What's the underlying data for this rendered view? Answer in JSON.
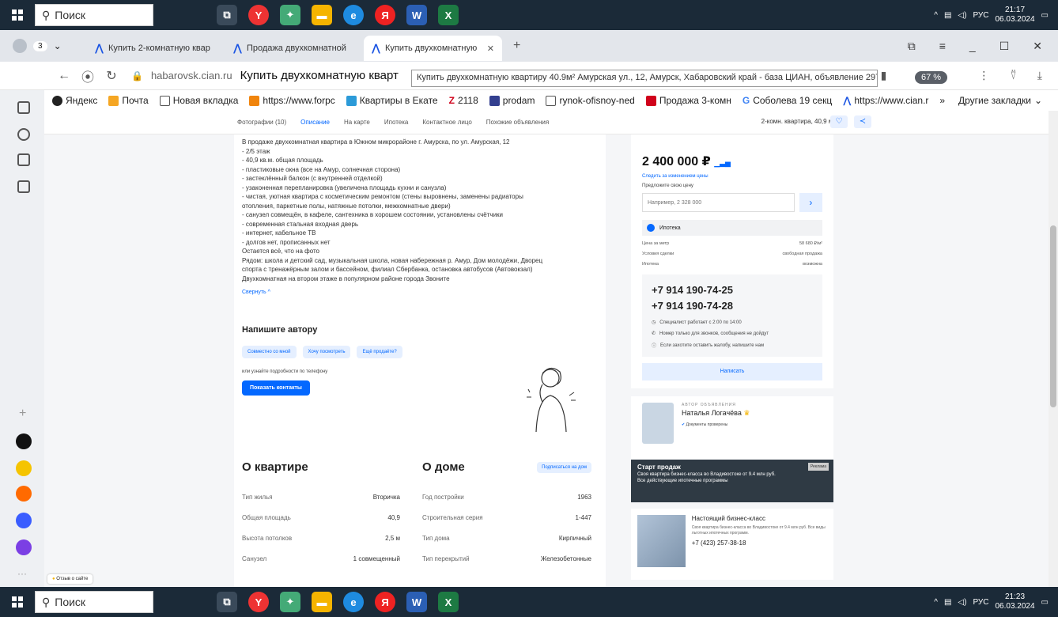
{
  "taskbar_top": {
    "search_placeholder": "Поиск",
    "lang": "РУС",
    "time": "21:17",
    "date": "06.03.2024"
  },
  "taskbar_bottom": {
    "search_placeholder": "Поиск",
    "lang": "РУС",
    "time": "21:23",
    "date": "06.03.2024"
  },
  "tabs": [
    {
      "label": "Купить 2-комнатную квар"
    },
    {
      "label": "Продажа двухкомнатной"
    },
    {
      "label": "Купить двухкомнатную"
    }
  ],
  "address": {
    "domain": "habarovsk.cian.ru",
    "title": "Купить двухкомнатную кварт",
    "tooltip": "Купить двухкомнатную квартиру 40.9м² Амурская ул., 12, Амурск, Хабаровский край - база ЦИАН, объявление 297926562",
    "zoom": "67 %"
  },
  "bookmarks": [
    {
      "label": "Яндекс",
      "color": "#222222"
    },
    {
      "label": "Почта",
      "color": "#f5a623"
    },
    {
      "label": "Новая вкладка",
      "color": "#ffffff"
    },
    {
      "label": "https://www.forpc",
      "color": "#f0840c"
    },
    {
      "label": "Квартиры в Екате",
      "color": "#2b9ad8"
    },
    {
      "label": "2118",
      "color": "#d0021b"
    },
    {
      "label": "prodam",
      "color": "#333f8f"
    },
    {
      "label": "rynok-ofisnoy-ned",
      "color": "#ffffff"
    },
    {
      "label": "Продажа 3-комн",
      "color": "#d0021b"
    },
    {
      "label": "Соболева 19 секц",
      "color": "#4285f4"
    },
    {
      "label": "https://www.cian.r",
      "color": "#1b55e3"
    }
  ],
  "bookmarks_more": "Другие закладки",
  "page_nav": {
    "items": [
      "Фотографии (10)",
      "Описание",
      "На карте",
      "Ипотека",
      "Контактное лицо",
      "Похожие объявления"
    ],
    "summary": "2-комн. квартира, 40,9 м²"
  },
  "description": [
    "В продаже двухкомнатная квартира в Южном микрорайоне г. Амурска, по ул. Амурская, 12",
    "- 2/5 этаж",
    "- 40,9 кв.м. общая площадь",
    "- пластиковые окна (все на Амур, солнечная сторона)",
    "- застеклённый балкон (с внутренней отделкой)",
    "- узаконенная перепланировка (увеличена площадь кухни и санузла)",
    "- чистая, уютная квартира с косметическим ремонтом (стены выровнены, заменены радиаторы",
    "отопления, паркетные полы, натяжные потолки, межкомнатные двери)",
    "- санузел совмещён, в кафеле, сантехника в хорошем состоянии, установлены счётчики",
    "- современная стальная входная дверь",
    "- интернет, кабельное ТВ",
    "- долгов нет, прописанных нет",
    "Остается всё, что на фото",
    "Рядом: школа и детский сад, музыкальная школа, новая набережная р. Амур, Дом молодёжи, Дворец",
    "спорта с тренажёрным залом и бассейном, филиал Сбербанка, остановка автобусов (Автовокзал)",
    "Двухкомнатная на втором этаже в популярном районе города Звоните"
  ],
  "collapse_label": "Свернуть ^",
  "write_author": {
    "title": "Напишите автору",
    "chips": [
      "Совместно со мной",
      "Хочу посмотреть",
      "Ещё продаёте?"
    ],
    "hint": "или узнайте подробности по телефону",
    "button": "Показать контакты"
  },
  "apartment": {
    "title": "О квартире",
    "rows": [
      {
        "label": "Тип жилья",
        "value": "Вторичка"
      },
      {
        "label": "Общая площадь",
        "value": "40,9"
      },
      {
        "label": "Высота потолков",
        "value": "2,5 м"
      },
      {
        "label": "Санузел",
        "value": "1 совмещенный"
      }
    ]
  },
  "house": {
    "title": "О доме",
    "subscribe": "Подписаться на дом",
    "rows": [
      {
        "label": "Год постройки",
        "value": "1963"
      },
      {
        "label": "Строительная серия",
        "value": "1-447"
      },
      {
        "label": "Тип дома",
        "value": "Кирпичный"
      },
      {
        "label": "Тип перекрытий",
        "value": "Железобетонные"
      }
    ]
  },
  "price_card": {
    "price": "2 400 000 ₽",
    "follow": "Следить за изменением цены",
    "offer_label": "Предложите свою цену",
    "offer_placeholder": "Например, 2 328 000",
    "mortgage": "Ипотека",
    "info": [
      {
        "label": "Цена за метр",
        "value": "58 680 ₽/м²"
      },
      {
        "label": "Условия сделки",
        "value": "свободная продажа"
      },
      {
        "label": "Ипотека",
        "value": "возможна"
      }
    ],
    "phones": [
      "+7 914 190-74-25",
      "+7 914 190-74-28"
    ],
    "notes": [
      "Специалист работает с 2:00 по 14:00",
      "Номер только для звонков, сообщения не дойдут",
      "Если захотите оставить жалобу, напишите нам"
    ],
    "write_button": "Написать"
  },
  "author": {
    "tag": "АВТОР ОБЪЯВЛЕНИЯ",
    "name": "Наталья Логачёва",
    "verified": "Документы проверены"
  },
  "ad_banner": {
    "label": "Реклама",
    "title": "Старт продаж",
    "line1": "Своя квартира бизнес-класса во Владивостоке от 9.4 млн руб.",
    "line2": "Все действующие ипотечные программы"
  },
  "ad2": {
    "title": "Настоящий бизнес-класс",
    "text": "Своя квартира бизнес-класса во Владивостоке от 9.4 млн руб. Все виды льготных ипотечных программ.",
    "phone": "+7 (423) 257-38-18"
  },
  "feedback": "Отзыв о сайте"
}
